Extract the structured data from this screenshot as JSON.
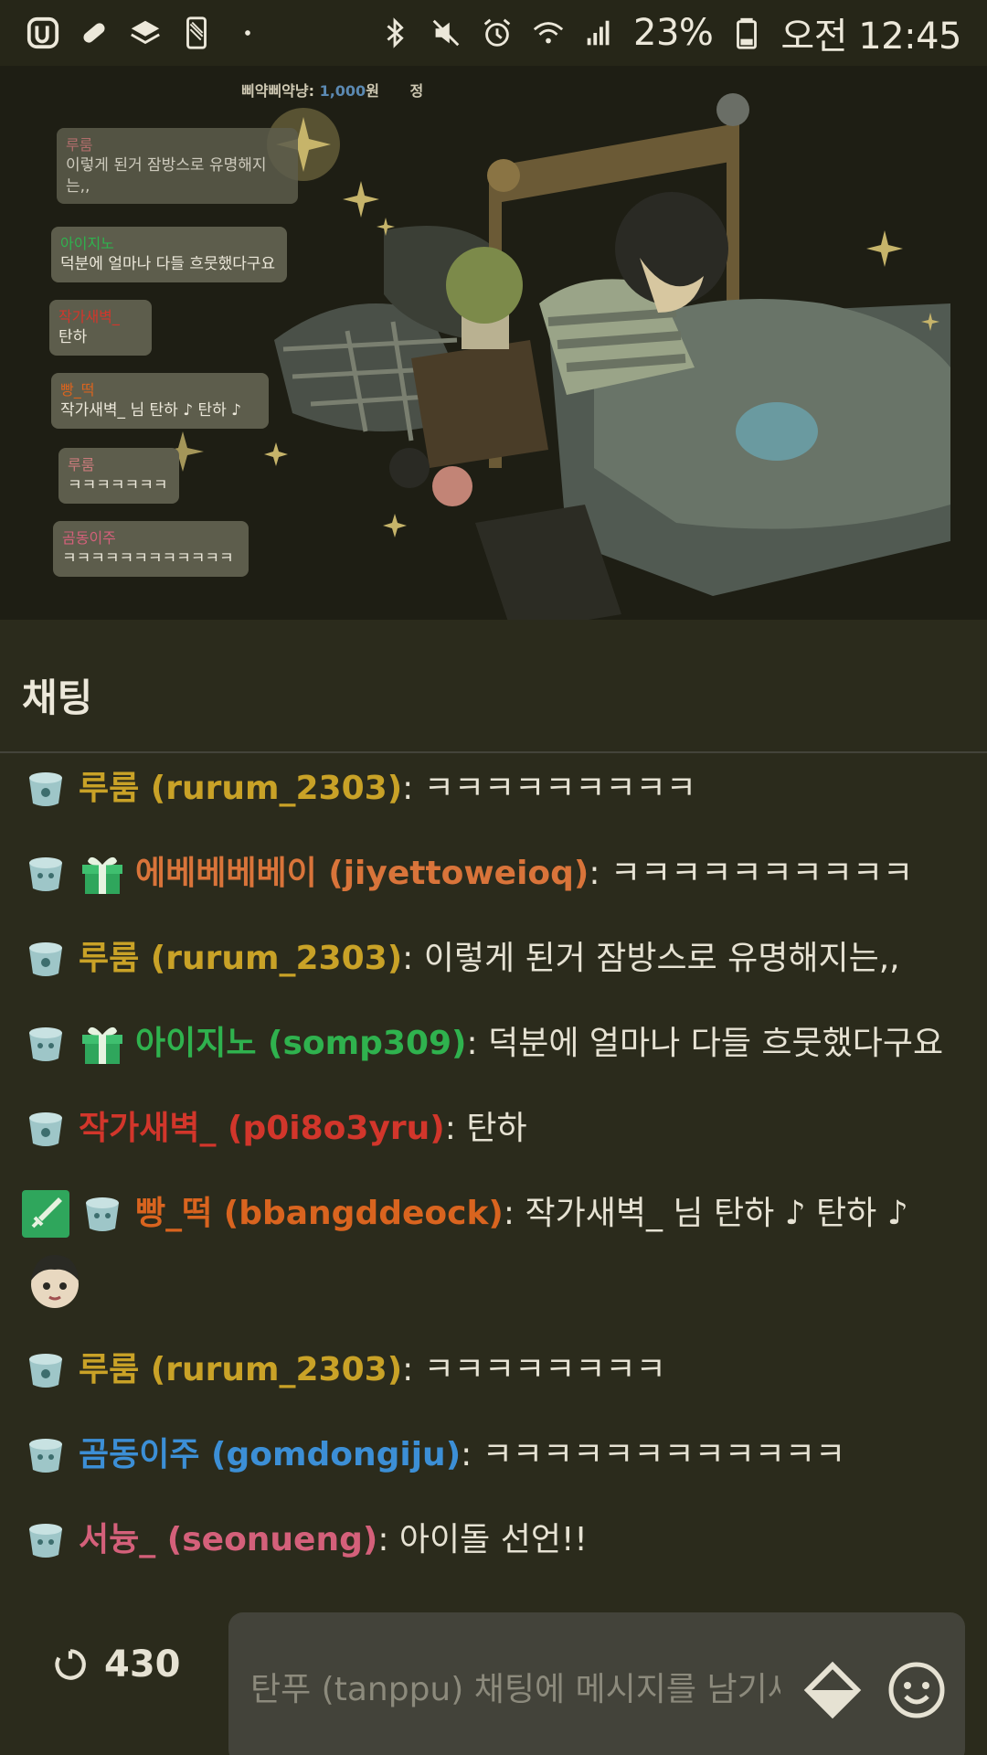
{
  "status_bar": {
    "battery": "23%",
    "time": "오전 12:45",
    "icons": [
      "u-plus-icon",
      "pill-icon",
      "layers-icon",
      "phone-icon",
      "dot-icon",
      "bluetooth-icon",
      "mute-icon",
      "alarm-icon",
      "wifi-icon",
      "signal-icon",
      "battery-icon"
    ]
  },
  "stream": {
    "donation_label": "삐약삐약냥:",
    "donation_amount": "1,000",
    "donation_unit": "원",
    "donation_extra": "정",
    "overlay_messages": [
      {
        "user": "루룸",
        "text": "이렇게 된거 잠방스로 유명해지는,,"
      },
      {
        "user": "아이지노",
        "text": "덕분에 얼마나 다들 흐뭇했다구요"
      },
      {
        "user": "작가새벽_",
        "text": "탄하"
      },
      {
        "user": "빵_떡",
        "text": "작가새벽_ 님 탄하 ♪ 탄하 ♪"
      },
      {
        "user": "루룸",
        "text": "ㅋㅋㅋㅋㅋㅋㅋ"
      },
      {
        "user": "곰동이주",
        "text": "ㅋㅋㅋㅋㅋㅋㅋㅋㅋㅋㅋㅋ"
      }
    ]
  },
  "chat": {
    "title": "채팅",
    "messages": [
      {
        "user": "루룸 (rurum_2303)",
        "color": "#c9a227",
        "text": ": ㅋㅋㅋㅋㅋㅋㅋㅋㅋ",
        "badges": [
          "cup-badge-icon"
        ]
      },
      {
        "user": "에베베베베이 (jiyettoweioq)",
        "color": "#d9743a",
        "text": ": ㅋㅋㅋㅋㅋㅋㅋㅋㅋㅋ",
        "badges": [
          "cup-badge-icon",
          "gift-badge-icon"
        ]
      },
      {
        "user": "루룸 (rurum_2303)",
        "color": "#c9a227",
        "text": ": 이렇게 된거 잠방스로 유명해지는,,",
        "badges": [
          "cup-badge-icon"
        ]
      },
      {
        "user": "아이지노 (somp309)",
        "color": "#2fb24e",
        "text": ": 덕분에 얼마나 다들 흐뭇했다구요",
        "badges": [
          "cup-badge-icon",
          "gift-badge-icon"
        ]
      },
      {
        "user": "작가새벽_ (p0i8o3yru)",
        "color": "#d2362b",
        "text": ": 탄하",
        "badges": [
          "cup-badge-icon"
        ]
      },
      {
        "user": "빵_떡 (bbangddeock)",
        "color": "#d9641f",
        "text": ": 작가새벽_ 님 탄하 ♪ 탄하 ♪",
        "badges": [
          "sword-badge-icon",
          "cup-badge-icon"
        ],
        "emote": "character-emote"
      },
      {
        "user": "루룸 (rurum_2303)",
        "color": "#c9a227",
        "text": ": ㅋㅋㅋㅋㅋㅋㅋㅋ",
        "badges": [
          "cup-badge-icon"
        ]
      },
      {
        "user": "곰동이주 (gomdongiju)",
        "color": "#3c8fd6",
        "text": ": ㅋㅋㅋㅋㅋㅋㅋㅋㅋㅋㅋㅋ",
        "badges": [
          "cup-badge-icon"
        ]
      },
      {
        "user": "서늉_ (seonueng)",
        "color": "#d4607a",
        "text": ": 아이돌 선언!!",
        "badges": [
          "cup-badge-icon"
        ]
      }
    ]
  },
  "bottom": {
    "viewer_count": "430",
    "input_placeholder": "탄푸 (tanppu) 채팅에 메시지를 남기세요",
    "icons": [
      "refresh-icon",
      "gem-icon",
      "emoji-icon"
    ]
  },
  "colors": {
    "background": "#2b2b1c",
    "input_bg": "#43433a",
    "text": "#e6e2d3"
  }
}
